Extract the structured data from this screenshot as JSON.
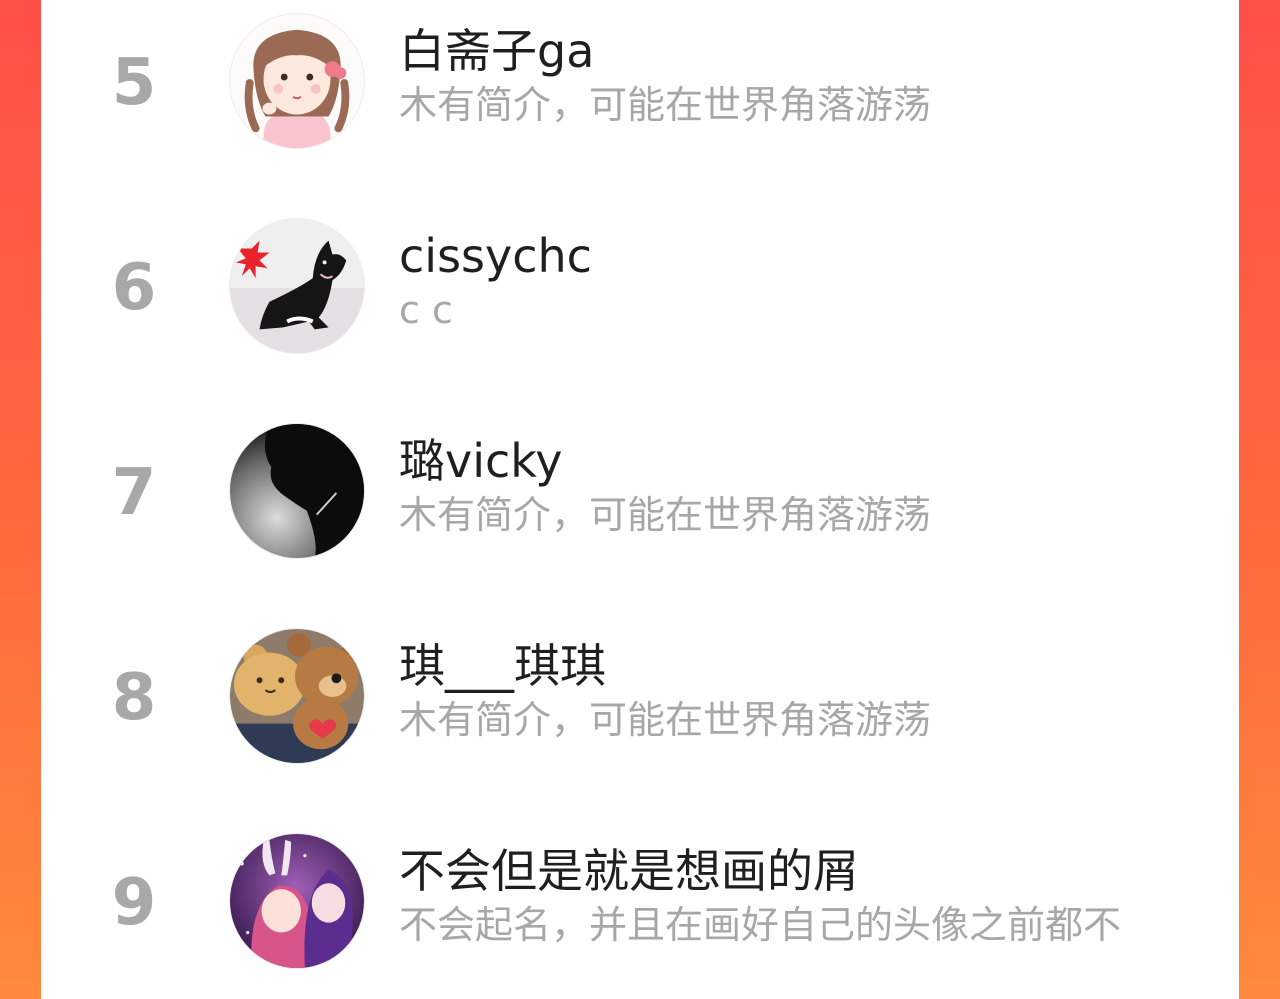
{
  "ranking": {
    "items": [
      {
        "rank": "5",
        "name": "白斋子ga",
        "bio": "木有简介，可能在世界角落游荡",
        "avatar_icon": "cartoon-girl-avatar-icon"
      },
      {
        "rank": "6",
        "name": "cissychc",
        "bio": "c c",
        "avatar_icon": "black-cat-avatar-icon"
      },
      {
        "rank": "7",
        "name": "璐vicky",
        "bio": "木有简介，可能在世界角落游荡",
        "avatar_icon": "silhouette-avatar-icon"
      },
      {
        "rank": "8",
        "name": "琪___琪琪",
        "bio": "木有简介，可能在世界角落游荡",
        "avatar_icon": "teddy-bear-avatar-icon"
      },
      {
        "rank": "9",
        "name": "不会但是就是想画的屑",
        "bio": "不会起名，并且在画好自己的头像之前都不",
        "avatar_icon": "anime-characters-avatar-icon"
      }
    ]
  },
  "colors": {
    "background_gradient_start": "#ff4f48",
    "background_gradient_end": "#ff8a3c",
    "panel": "#ffffff",
    "rank_number": "#a8a8a8",
    "name_text": "#1f1f1f",
    "bio_text": "#a7a7a7"
  }
}
